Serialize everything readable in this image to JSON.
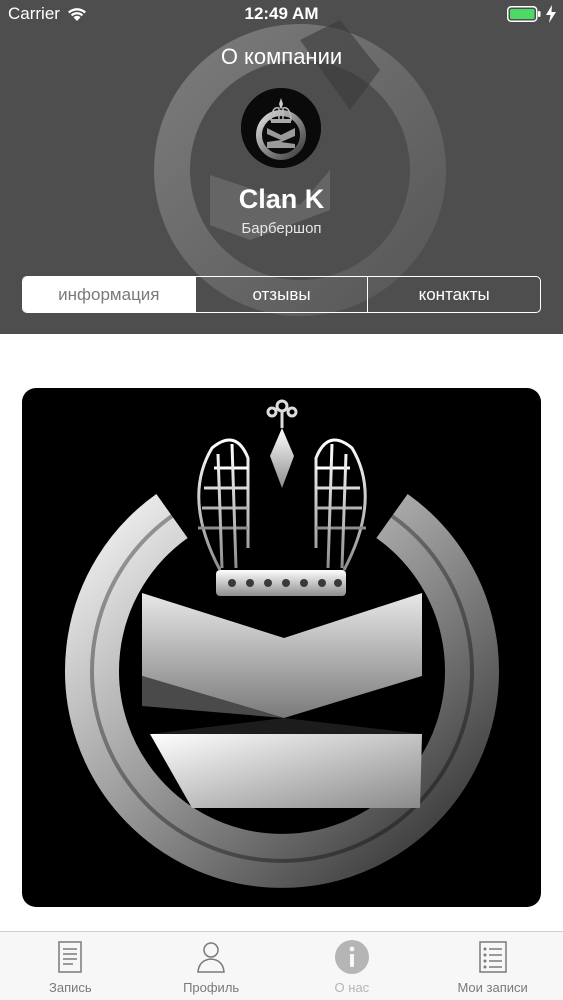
{
  "status_bar": {
    "carrier": "Carrier",
    "time": "12:49 AM",
    "wifi_icon": "wifi-icon",
    "battery_icon": "battery-full-icon",
    "charging_icon": "bolt-icon",
    "battery_color": "#4cd964"
  },
  "header": {
    "title": "О компании",
    "company_name": "Clan K",
    "company_category": "Барбершоп",
    "background_color": "#4e4e4e"
  },
  "segments": {
    "items": [
      {
        "label": "информация",
        "active": true
      },
      {
        "label": "отзывы",
        "active": false
      },
      {
        "label": "контакты",
        "active": false
      }
    ]
  },
  "main": {
    "logo_icon": "clan-k-crown-logo"
  },
  "tabbar": {
    "items": [
      {
        "label": "Запись",
        "icon": "document-icon",
        "active": false
      },
      {
        "label": "Профиль",
        "icon": "person-icon",
        "active": false
      },
      {
        "label": "О нас",
        "icon": "info-icon",
        "active": true
      },
      {
        "label": "Мои записи",
        "icon": "list-icon",
        "active": false
      }
    ]
  }
}
